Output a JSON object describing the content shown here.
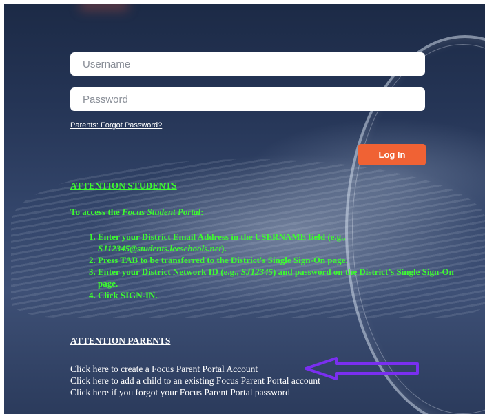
{
  "login_form": {
    "username_placeholder": "Username",
    "password_placeholder": "Password",
    "forgot_password_link": "Parents: Forgot Password?",
    "login_button": "Log In",
    "login_button_color": "#f06234"
  },
  "students": {
    "heading": "ATTENTION STUDENTS",
    "access_prefix": "To access the ",
    "access_portal": "Focus Student Portal",
    "access_suffix": ":",
    "text_color": "#3dfc2f",
    "steps": [
      {
        "a": "Enter your District Email Address in the USERNAME field (e.g., ",
        "em": "SJ12345@students.leeschools.net",
        "b": ")."
      },
      {
        "a": "Press TAB to be transferred to the District's Single Sign-On page.",
        "em": "",
        "b": ""
      },
      {
        "a": "Enter your District Network ID (e.g., ",
        "em": "SJ12345",
        "b": ") and password on the District’s Single Sign-On page."
      },
      {
        "a": "Click SIGN-IN.",
        "em": "",
        "b": ""
      }
    ]
  },
  "parents": {
    "heading": "ATTENTION PARENTS",
    "links": [
      "Click here to create a Focus Parent Portal Account",
      "Click here to add a child to an existing Focus Parent Portal account",
      "Click here if you forgot your Focus Parent Portal password"
    ]
  },
  "annotation": {
    "arrow_color": "#7a2ff0",
    "arrow_icon": "left-arrow-outline-icon"
  }
}
